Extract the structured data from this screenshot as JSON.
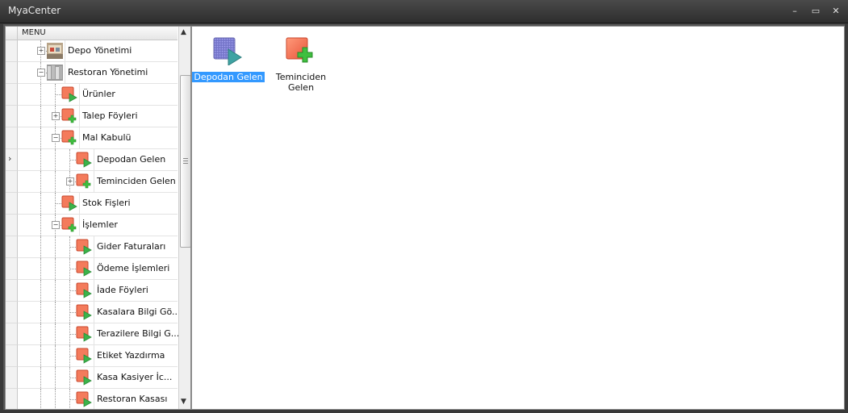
{
  "window": {
    "title": "MyaCenter",
    "minimize_glyph": "–",
    "maximize_glyph": "▭",
    "close_glyph": "✕"
  },
  "tree": {
    "header": "MENU",
    "current_row_indicator": "›",
    "nodes": [
      {
        "label": "Depo Yönetimi",
        "level": 0,
        "expander": "+",
        "icon": "depot-photo-icon"
      },
      {
        "label": "Restoran Yönetimi",
        "level": 0,
        "expander": "−",
        "icon": "restaurant-photo-icon"
      },
      {
        "label": "Ürünler",
        "level": 1,
        "expander": "",
        "icon": "form-play-icon"
      },
      {
        "label": "Talep Föyleri",
        "level": 1,
        "expander": "+",
        "icon": "form-add-icon"
      },
      {
        "label": "Mal Kabulü",
        "level": 1,
        "expander": "−",
        "icon": "form-add-icon"
      },
      {
        "label": "Depodan Gelen",
        "level": 2,
        "expander": "",
        "icon": "form-play-icon"
      },
      {
        "label": "Teminciden Gelen",
        "level": 2,
        "expander": "+",
        "icon": "form-add-icon"
      },
      {
        "label": "Stok Fişleri",
        "level": 1,
        "expander": "",
        "icon": "form-play-icon"
      },
      {
        "label": "İşlemler",
        "level": 1,
        "expander": "−",
        "icon": "form-add-icon"
      },
      {
        "label": "Gider Faturaları",
        "level": 2,
        "expander": "",
        "icon": "form-play-icon"
      },
      {
        "label": "Ödeme İşlemleri",
        "level": 2,
        "expander": "",
        "icon": "form-play-icon"
      },
      {
        "label": "İade Föyleri",
        "level": 2,
        "expander": "",
        "icon": "form-play-icon"
      },
      {
        "label": "Kasalara Bilgi Gö...",
        "level": 2,
        "expander": "",
        "icon": "form-play-icon"
      },
      {
        "label": "Terazilere Bilgi G...",
        "level": 2,
        "expander": "",
        "icon": "form-play-icon"
      },
      {
        "label": "Etiket Yazdırma",
        "level": 2,
        "expander": "",
        "icon": "form-play-icon"
      },
      {
        "label": "Kasa Kasiyer İc...",
        "level": 2,
        "expander": "",
        "icon": "form-play-icon"
      },
      {
        "label": "Restoran Kasası",
        "level": 2,
        "expander": "",
        "icon": "form-play-icon"
      }
    ]
  },
  "content": {
    "tiles": [
      {
        "label": "Depodan Gelen",
        "icon": "form-play-selected-icon",
        "selected": true
      },
      {
        "label": "Teminciden Gelen",
        "icon": "form-add-icon",
        "selected": false
      }
    ]
  },
  "colors": {
    "selection": "#3399ff",
    "form_icon": "#f06a4a",
    "play_green": "#3bb34a",
    "add_green": "#3fbf3f"
  }
}
